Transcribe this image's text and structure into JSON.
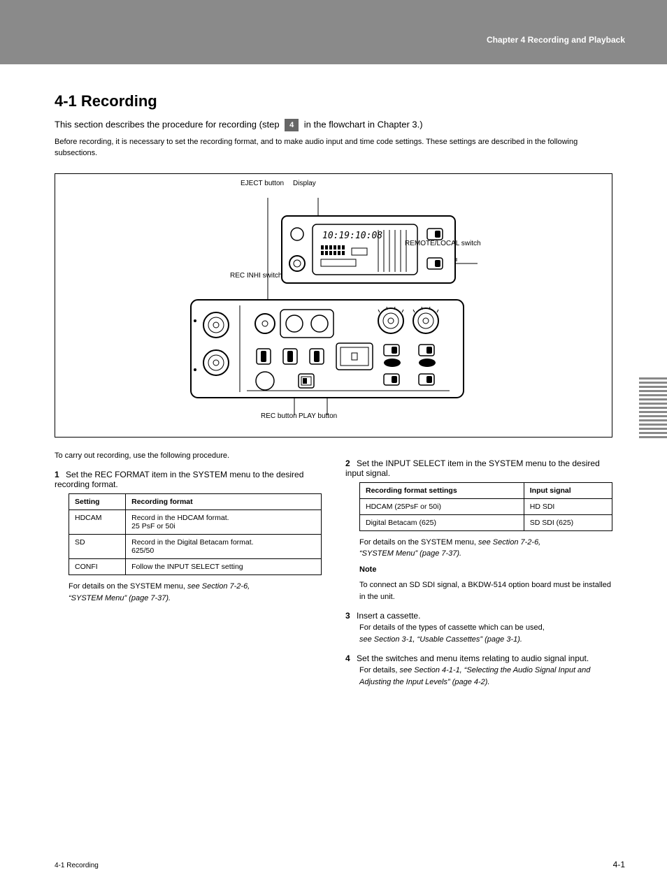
{
  "banner": "Chapter 4  Recording and Playback",
  "heading": "4-1 Recording",
  "intro_line_prefix": "This section describes the procedure for recording (step ",
  "intro_step": "4",
  "intro_line_suffix": " in the flowchart in Chapter 3.)",
  "intro_body": "Before recording, it is necessary to set the recording format, and to make audio input and time code settings. These settings are described in the following subsections.",
  "figure": {
    "label1": "EJECT button",
    "label2": "Display",
    "label3": "REMOTE/LOCAL switch",
    "label4": "REC INHI switch",
    "label5": "REC button",
    "label6": "PLAY button"
  },
  "left": {
    "lead": "To carry out recording, use the following procedure.",
    "step1_num": "1",
    "step1_body": "Set the REC FORMAT item in the SYSTEM menu to the desired recording format.",
    "table1": {
      "h1": "Setting",
      "h2": "Recording format",
      "r1c1": "HDCAM",
      "r1c2": "Record in the HDCAM format.\n25 PsF or 50i",
      "r2c1": "SD",
      "r2c2": "Record in the Digital Betacam format.\n625/50",
      "r3c1": "CONFI",
      "r3c2": "Follow the INPUT SELECT setting"
    },
    "note_prefix": "For details on the SYSTEM menu, ",
    "note_italic": "see Section 7-2-6,\n“SYSTEM Menu” (page 7-37)."
  },
  "right": {
    "step2_num": "2",
    "step2_body": "Set the INPUT SELECT item in the SYSTEM menu to the desired input signal.",
    "table2": {
      "h1": "Recording format settings",
      "h2": "Input signal",
      "r1c1": "HDCAM (25PsF or 50i)",
      "r1c2": "HD SDI",
      "r2c1": "Digital Betacam (625)",
      "r2c2": "SD SDI (625)"
    },
    "note_prefix": "For details on the SYSTEM menu, ",
    "note_italic": "see Section 7-2-6,\n“SYSTEM Menu” (page 7-37).",
    "note2_label": "Note",
    "note2_body": "To connect an SD SDI signal, a BKDW-514 option board must be installed in the unit.",
    "step3_num": "3",
    "step3_body": "Insert a cassette.",
    "step3_sub_prefix": "For details of the types of cassette which can be used,\n",
    "step3_sub_italic": "see Section 3-1, “Usable Cassettes” (page 3-1).",
    "step4_num": "4",
    "step4_body": "Set the switches and menu items relating to audio signal input.",
    "step4_sub_prefix": "For details, ",
    "step4_sub_italic": "see Section 4-1-1, “Selecting the Audio Signal Input and Adjusting the Input Levels” (page 4-2)."
  },
  "footer_title": "4-1 Recording",
  "footer_page": "4-1",
  "side_label": "Chapter 4  Recording and Playback"
}
